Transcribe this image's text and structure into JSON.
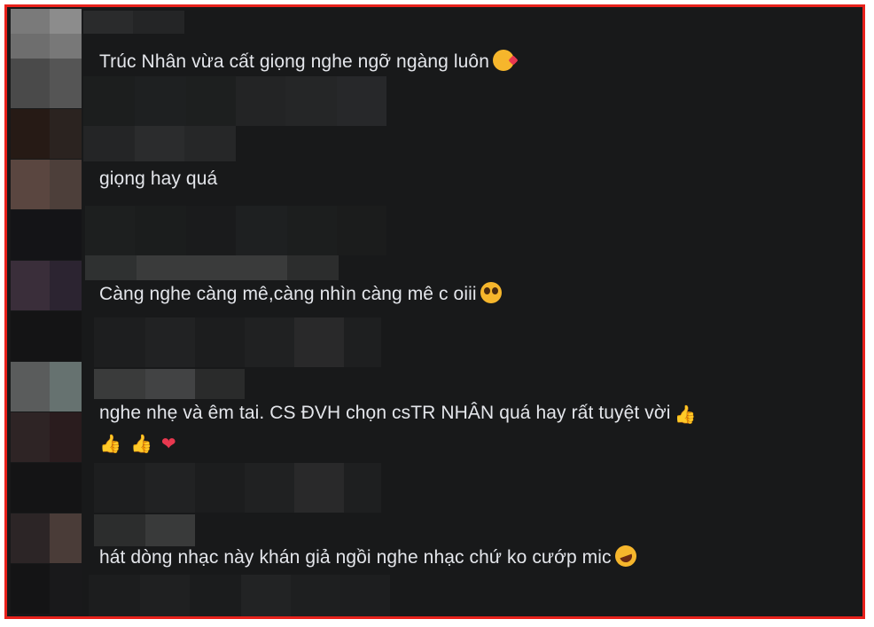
{
  "comments": [
    {
      "text": "Trúc Nhân vừa cất giọng nghe ngỡ ngàng luôn",
      "emoji": "smiling-face-with-hearts-icon"
    },
    {
      "text": "giọng hay quá"
    },
    {
      "text": "Càng nghe càng mê,càng nhìn càng mê c oiii",
      "emoji": "pleading-face-icon"
    },
    {
      "text": "nghe nhẹ và êm tai. CS ĐVH chọn csTR NHÂN quá hay rất tuyệt vời",
      "emoji": "thumbs-up-icon",
      "line2_emojis": [
        "👍",
        "👍",
        "❤"
      ]
    },
    {
      "text": "hát dòng nhạc này khán giả ngồi nghe nhạc chứ ko cướp mic",
      "emoji": "rolling-laughing-icon"
    }
  ],
  "emoji_glyphs": {
    "thumbs_up": "👍",
    "heart": "❤"
  },
  "colors": {
    "background": "#18191a",
    "text": "#e4e6eb",
    "frame": "#e8211b"
  }
}
